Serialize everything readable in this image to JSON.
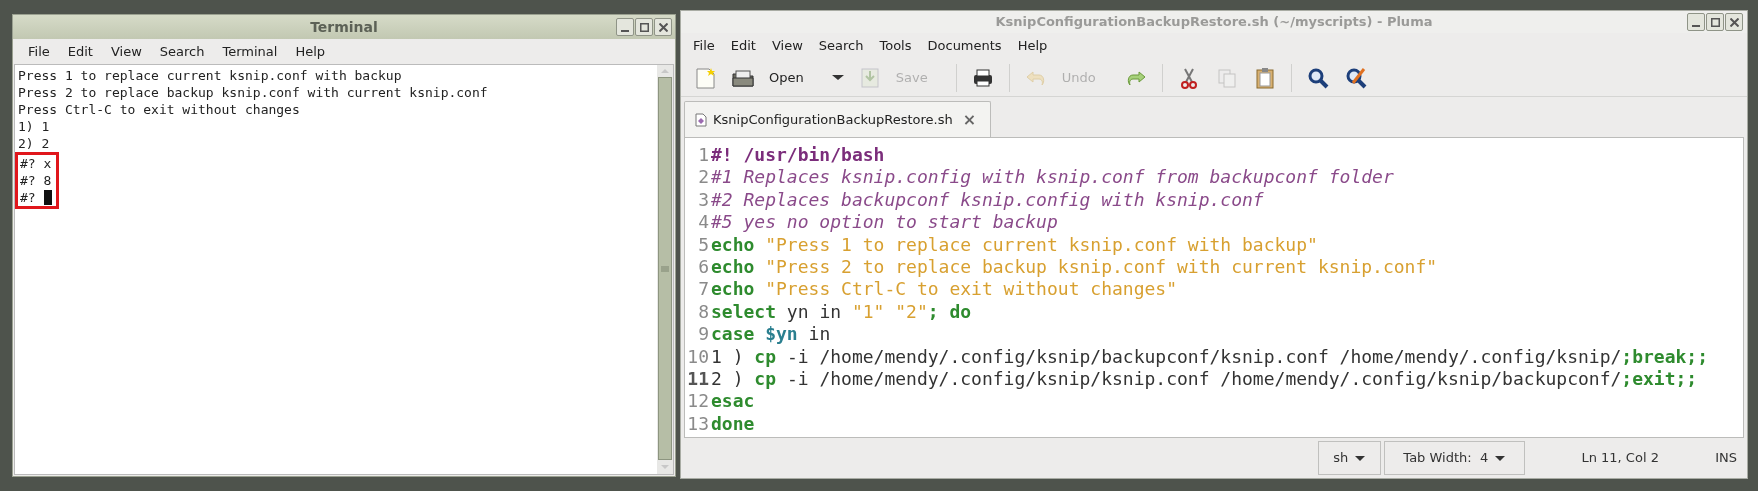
{
  "terminal": {
    "title": "Terminal",
    "menu": [
      "File",
      "Edit",
      "View",
      "Search",
      "Terminal",
      "Help"
    ],
    "lines": [
      {
        "text": "Press 1 to replace current ksnip.conf with backup",
        "boxed": false,
        "cursor": false
      },
      {
        "text": "Press 2 to replace backup ksnip.conf with current ksnip.conf",
        "boxed": false,
        "cursor": false
      },
      {
        "text": "Press Ctrl-C to exit without changes",
        "boxed": false,
        "cursor": false
      },
      {
        "text": "1) 1",
        "boxed": false,
        "cursor": false
      },
      {
        "text": "2) 2",
        "boxed": false,
        "cursor": false
      },
      {
        "text": "#? x",
        "boxed": true,
        "cursor": false
      },
      {
        "text": "#? 8",
        "boxed": true,
        "cursor": false
      },
      {
        "text": "#?",
        "boxed": true,
        "cursor": true
      }
    ]
  },
  "editor": {
    "title": "KsnipConfigurationBackupRestore.sh (~/myscripts) - Pluma",
    "menu": [
      "File",
      "Edit",
      "View",
      "Search",
      "Tools",
      "Documents",
      "Help"
    ],
    "toolbar": [
      {
        "kind": "new",
        "disabled": false
      },
      {
        "kind": "open",
        "label": "Open",
        "disabled": false
      },
      {
        "kind": "dropdown",
        "disabled": false
      },
      {
        "kind": "save",
        "label": "Save",
        "disabled": true
      },
      {
        "kind": "separator"
      },
      {
        "kind": "print",
        "disabled": false
      },
      {
        "kind": "separator"
      },
      {
        "kind": "undo",
        "label": "Undo",
        "disabled": true
      },
      {
        "kind": "redo",
        "disabled": false
      },
      {
        "kind": "separator"
      },
      {
        "kind": "cut",
        "disabled": false
      },
      {
        "kind": "copy",
        "disabled": true
      },
      {
        "kind": "paste",
        "disabled": false
      },
      {
        "kind": "separator"
      },
      {
        "kind": "find",
        "disabled": false
      },
      {
        "kind": "replace",
        "disabled": false
      }
    ],
    "tab": {
      "label": "KsnipConfigurationBackupRestore.sh",
      "close": "×"
    },
    "code": [
      {
        "number": "1",
        "current": false,
        "tokens": [
          {
            "t": "#! /usr/bin/bash",
            "kind": "shebang"
          }
        ]
      },
      {
        "number": "2",
        "current": false,
        "tokens": [
          {
            "t": "#1 Replaces ksnip.config with ksnip.conf from backupconf folder",
            "kind": "comment"
          }
        ]
      },
      {
        "number": "3",
        "current": false,
        "tokens": [
          {
            "t": "#2 Replaces backupconf ksnip.config with ksnip.conf",
            "kind": "comment"
          }
        ]
      },
      {
        "number": "4",
        "current": false,
        "tokens": [
          {
            "t": "#5 yes no option to start backup",
            "kind": "comment"
          }
        ]
      },
      {
        "number": "5",
        "current": false,
        "tokens": [
          {
            "t": "echo",
            "kind": "keyword"
          },
          {
            "t": " \"Press 1 to replace current ksnip.conf with backup\"",
            "kind": "string"
          }
        ]
      },
      {
        "number": "6",
        "current": false,
        "tokens": [
          {
            "t": "echo",
            "kind": "keyword"
          },
          {
            "t": " \"Press 2 to replace backup ksnip.conf with current ksnip.conf\"",
            "kind": "string"
          }
        ]
      },
      {
        "number": "7",
        "current": false,
        "tokens": [
          {
            "t": "echo",
            "kind": "keyword"
          },
          {
            "t": " \"Press Ctrl-C to exit without changes\"",
            "kind": "string"
          }
        ]
      },
      {
        "number": "8",
        "current": false,
        "tokens": [
          {
            "t": "select",
            "kind": "keyword"
          },
          {
            "t": " yn in ",
            "kind": "plain"
          },
          {
            "t": "\"1\" \"2\"",
            "kind": "string"
          },
          {
            "t": "; do",
            "kind": "keyword"
          }
        ]
      },
      {
        "number": "9",
        "current": false,
        "tokens": [
          {
            "t": "case",
            "kind": "keyword"
          },
          {
            "t": " $yn",
            "kind": "variable"
          },
          {
            "t": " in",
            "kind": "plain"
          }
        ]
      },
      {
        "number": "10",
        "current": false,
        "tokens": [
          {
            "t": "1 ) ",
            "kind": "plain"
          },
          {
            "t": "cp",
            "kind": "keyword"
          },
          {
            "t": " -i /home/mendy/.config/ksnip/backupconf/ksnip.conf /home/mendy/.config/ksnip/",
            "kind": "plain"
          },
          {
            "t": ";break;;",
            "kind": "keyword"
          }
        ]
      },
      {
        "number": "11",
        "current": true,
        "tokens": [
          {
            "t": "2 ) ",
            "kind": "plain"
          },
          {
            "t": "cp",
            "kind": "keyword"
          },
          {
            "t": " -i /home/mendy/.config/ksnip/ksnip.conf /home/mendy/.config/ksnip/backupconf/",
            "kind": "plain"
          },
          {
            "t": ";exit;;",
            "kind": "keyword"
          }
        ]
      },
      {
        "number": "12",
        "current": false,
        "tokens": [
          {
            "t": "esac",
            "kind": "keyword"
          }
        ]
      },
      {
        "number": "13",
        "current": false,
        "tokens": [
          {
            "t": "done",
            "kind": "keyword"
          }
        ]
      }
    ],
    "status": {
      "language": "sh",
      "tab_width": "Tab Width:  4",
      "position": "Ln 11, Col 2",
      "mode": "INS"
    }
  }
}
